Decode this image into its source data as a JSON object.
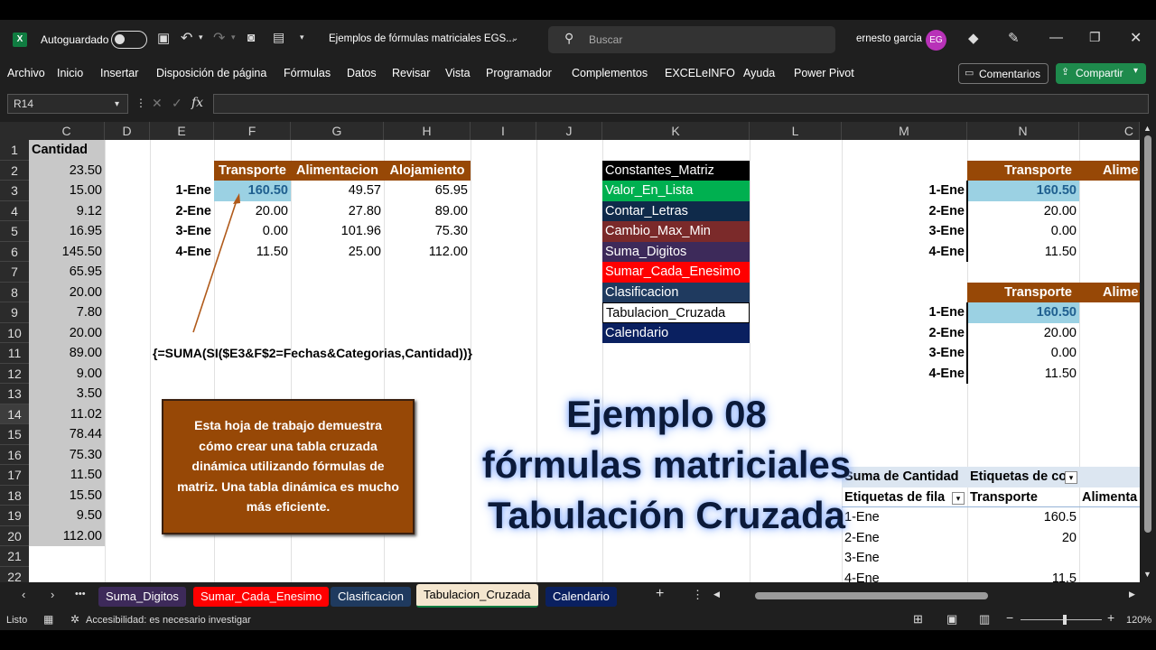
{
  "titlebar": {
    "autosave_label": "Autoguardado",
    "doc_title": "Ejemplos de fórmulas matriciales EGS...",
    "search_placeholder": "Buscar",
    "user_name": "ernesto garcia",
    "user_initials": "EG"
  },
  "menu": {
    "items": [
      "Archivo",
      "Inicio",
      "Insertar",
      "Disposición de página",
      "Fórmulas",
      "Datos",
      "Revisar",
      "Vista",
      "Programador",
      "Complementos",
      "EXCELeINFO",
      "Ayuda",
      "Power Pivot"
    ],
    "comments_label": "Comentarios",
    "share_label": "Compartir"
  },
  "formula_bar": {
    "name_box": "R14",
    "fx": "fx",
    "formula": ""
  },
  "columns": [
    "C",
    "D",
    "E",
    "F",
    "G",
    "H",
    "I",
    "J",
    "K",
    "L",
    "M",
    "N",
    "C"
  ],
  "rows": [
    "1",
    "2",
    "3",
    "4",
    "5",
    "6",
    "7",
    "8",
    "9",
    "10",
    "11",
    "12",
    "13",
    "14",
    "15",
    "16",
    "17",
    "18",
    "19",
    "20",
    "21",
    "22"
  ],
  "cantidad": {
    "header": "Cantidad",
    "values": [
      "23.50",
      "15.00",
      "9.12",
      "16.95",
      "145.50",
      "65.95",
      "20.00",
      "7.80",
      "20.00",
      "89.00",
      "9.00",
      "3.50",
      "11.02",
      "78.44",
      "75.30",
      "11.50",
      "15.50",
      "9.50",
      "112.00"
    ]
  },
  "crosstab": {
    "headers": [
      "Transporte",
      "Alimentacion",
      "Alojamiento"
    ],
    "rows": [
      {
        "label": "1-Ene",
        "values": [
          "160.50",
          "49.57",
          "65.95"
        ]
      },
      {
        "label": "2-Ene",
        "values": [
          "20.00",
          "27.80",
          "89.00"
        ]
      },
      {
        "label": "3-Ene",
        "values": [
          "0.00",
          "101.96",
          "75.30"
        ]
      },
      {
        "label": "4-Ene",
        "values": [
          "11.50",
          "25.00",
          "112.00"
        ]
      }
    ],
    "formula": "{=SUMA(SI($E3&F$2=Fechas&Categorias,Cantidad))}"
  },
  "note": "Esta hoja de trabajo demuestra cómo crear una tabla cruzada dinámica utilizando fórmulas de matriz. Una tabla dinámica es mucho más eficiente.",
  "constants": {
    "header": "Constantes_Matriz",
    "items": [
      {
        "label": "Valor_En_Lista",
        "color": "#00b050",
        "text": "#ffffff"
      },
      {
        "label": "Contar_Letras",
        "color": "#0f2a4a",
        "text": "#ffffff"
      },
      {
        "label": "Cambio_Max_Min",
        "color": "#7b2a2a",
        "text": "#ffffff"
      },
      {
        "label": "Suma_Digitos",
        "color": "#3d2a5a",
        "text": "#ffffff"
      },
      {
        "label": "Sumar_Cada_Enesimo",
        "color": "#ff0000",
        "text": "#ffffff"
      },
      {
        "label": "Clasificacion",
        "color": "#1f3a5f",
        "text": "#ffffff"
      },
      {
        "label": "Tabulacion_Cruzada",
        "color": "#ffffff",
        "text": "#000000"
      },
      {
        "label": "Calendario",
        "color": "#0a2060",
        "text": "#ffffff"
      }
    ]
  },
  "right_table1": {
    "headers": [
      "Transporte",
      "Alime"
    ],
    "rows": [
      {
        "label": "1-Ene",
        "value": "160.50"
      },
      {
        "label": "2-Ene",
        "value": "20.00"
      },
      {
        "label": "3-Ene",
        "value": "0.00"
      },
      {
        "label": "4-Ene",
        "value": "11.50"
      }
    ]
  },
  "right_table2": {
    "headers": [
      "Transporte",
      "Alime"
    ],
    "rows": [
      {
        "label": "1-Ene",
        "value": "160.50"
      },
      {
        "label": "2-Ene",
        "value": "20.00"
      },
      {
        "label": "3-Ene",
        "value": "0.00"
      },
      {
        "label": "4-Ene",
        "value": "11.50"
      }
    ]
  },
  "pivot": {
    "title": "Suma de Cantidad",
    "col_labels": "Etiquetas de co",
    "row_labels": "Etiquetas de fila",
    "col1": "Transporte",
    "col2": "Alimenta",
    "rows": [
      {
        "label": "1-Ene",
        "value": "160.5"
      },
      {
        "label": "2-Ene",
        "value": "20"
      },
      {
        "label": "3-Ene",
        "value": ""
      },
      {
        "label": "4-Ene",
        "value": "11.5"
      }
    ]
  },
  "overlay_title": {
    "line1": "Ejemplo 08",
    "line2": "fórmulas matriciales",
    "line3": "Tabulación Cruzada"
  },
  "tabs": [
    {
      "label": "Suma_Digitos",
      "color": "#3d2a5a"
    },
    {
      "label": "Sumar_Cada_Enesimo",
      "color": "#ff0000"
    },
    {
      "label": "Clasificacion",
      "color": "#1f3a5f"
    },
    {
      "label": "Tabulacion_Cruzada",
      "color": "#f4e6cf"
    },
    {
      "label": "Calendario",
      "color": "#0a2060"
    }
  ],
  "status": {
    "ready": "Listo",
    "accessibility": "Accesibilidad: es necesario investigar",
    "zoom": "120%"
  }
}
